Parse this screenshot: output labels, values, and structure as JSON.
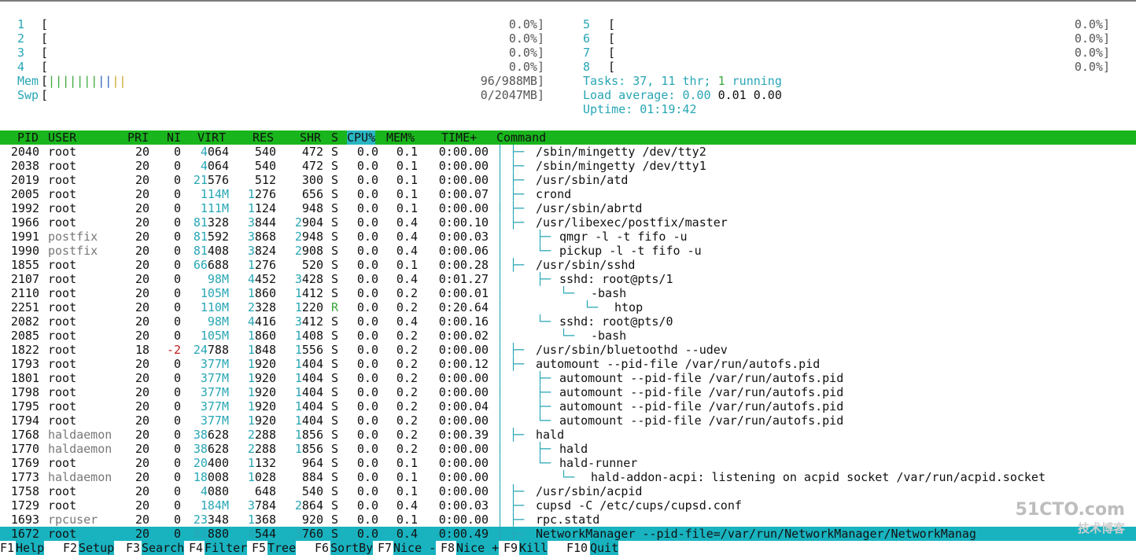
{
  "cpus_left": [
    {
      "id": "1",
      "value": "0.0%"
    },
    {
      "id": "2",
      "value": "0.0%"
    },
    {
      "id": "3",
      "value": "0.0%"
    },
    {
      "id": "4",
      "value": "0.0%"
    }
  ],
  "cpus_right": [
    {
      "id": "5",
      "value": "0.0%"
    },
    {
      "id": "6",
      "value": "0.0%"
    },
    {
      "id": "7",
      "value": "0.0%"
    },
    {
      "id": "8",
      "value": "0.0%"
    }
  ],
  "mem": {
    "label": "Mem",
    "bar": "|||||||||||",
    "value": "96/988MB"
  },
  "swp": {
    "label": "Swp",
    "value": "0/2047MB"
  },
  "tasks": {
    "label": "Tasks:",
    "tasks": "37,",
    "threads": "11",
    "thr_label": "thr;",
    "running": "1",
    "running_label": "running"
  },
  "load": {
    "label": "Load average:",
    "l1": "0.00",
    "l5": "0.01",
    "l15": "0.00"
  },
  "uptime": {
    "label": "Uptime:",
    "value": "01:19:42"
  },
  "header": {
    "pid": "PID",
    "user": "USER",
    "pri": "PRI",
    "ni": "NI",
    "virt": "VIRT",
    "res": "RES",
    "shr": "SHR",
    "s": "S",
    "cpu": "CPU%",
    "mem": "MEM%",
    "time": "TIME+",
    "command": "Command"
  },
  "processes": [
    {
      "pid": "2040",
      "user": "root",
      "pri": "20",
      "ni": "0",
      "virt": "4064",
      "res": "540",
      "shr": "472",
      "s": "S",
      "cpu": "0.0",
      "mem": "0.1",
      "time": "0:00.00",
      "tree": "├─",
      "indent": 0,
      "command": "/sbin/mingetty /dev/tty2"
    },
    {
      "pid": "2038",
      "user": "root",
      "pri": "20",
      "ni": "0",
      "virt": "4064",
      "res": "540",
      "shr": "472",
      "s": "S",
      "cpu": "0.0",
      "mem": "0.1",
      "time": "0:00.00",
      "tree": "├─",
      "indent": 0,
      "command": "/sbin/mingetty /dev/tty1"
    },
    {
      "pid": "2019",
      "user": "root",
      "pri": "20",
      "ni": "0",
      "virt": "21576",
      "res": "512",
      "shr": "300",
      "s": "S",
      "cpu": "0.0",
      "mem": "0.1",
      "time": "0:00.00",
      "tree": "├─",
      "indent": 0,
      "command": "/usr/sbin/atd"
    },
    {
      "pid": "2005",
      "user": "root",
      "pri": "20",
      "ni": "0",
      "virt": "114M",
      "res": "1276",
      "shr": "656",
      "s": "S",
      "cpu": "0.0",
      "mem": "0.1",
      "time": "0:00.07",
      "tree": "├─",
      "indent": 0,
      "command": "crond"
    },
    {
      "pid": "1992",
      "user": "root",
      "pri": "20",
      "ni": "0",
      "virt": "111M",
      "res": "1124",
      "shr": "948",
      "s": "S",
      "cpu": "0.0",
      "mem": "0.1",
      "time": "0:00.00",
      "tree": "├─",
      "indent": 0,
      "command": "/usr/sbin/abrtd"
    },
    {
      "pid": "1966",
      "user": "root",
      "pri": "20",
      "ni": "0",
      "virt": "81328",
      "res": "3844",
      "shr": "2904",
      "s": "S",
      "cpu": "0.0",
      "mem": "0.4",
      "time": "0:00.10",
      "tree": "├─",
      "indent": 0,
      "command": "/usr/libexec/postfix/master"
    },
    {
      "pid": "1991",
      "user": "postfix",
      "pri": "20",
      "ni": "0",
      "virt": "81592",
      "res": "3868",
      "shr": "2948",
      "s": "S",
      "cpu": "0.0",
      "mem": "0.4",
      "time": "0:00.03",
      "tree": "├─",
      "indent": 1,
      "command": "qmgr -l -t fifo -u"
    },
    {
      "pid": "1990",
      "user": "postfix",
      "pri": "20",
      "ni": "0",
      "virt": "81408",
      "res": "3824",
      "shr": "2908",
      "s": "S",
      "cpu": "0.0",
      "mem": "0.4",
      "time": "0:00.06",
      "tree": "└─",
      "indent": 1,
      "command": "pickup -l -t fifo -u"
    },
    {
      "pid": "1855",
      "user": "root",
      "pri": "20",
      "ni": "0",
      "virt": "66688",
      "res": "1276",
      "shr": "520",
      "s": "S",
      "cpu": "0.0",
      "mem": "0.1",
      "time": "0:00.28",
      "tree": "├─",
      "indent": 0,
      "command": "/usr/sbin/sshd"
    },
    {
      "pid": "2107",
      "user": "root",
      "pri": "20",
      "ni": "0",
      "virt": "98M",
      "res": "4452",
      "shr": "3428",
      "s": "S",
      "cpu": "0.0",
      "mem": "0.4",
      "time": "0:01.27",
      "tree": "├─",
      "indent": 1,
      "command": "sshd: root@pts/1"
    },
    {
      "pid": "2110",
      "user": "root",
      "pri": "20",
      "ni": "0",
      "virt": "105M",
      "res": "1860",
      "shr": "1412",
      "s": "S",
      "cpu": "0.0",
      "mem": "0.2",
      "time": "0:00.01",
      "tree": "└─",
      "indent": 2,
      "command": "-bash"
    },
    {
      "pid": "2251",
      "user": "root",
      "pri": "20",
      "ni": "0",
      "virt": "110M",
      "res": "2328",
      "shr": "1220",
      "s": "R",
      "cpu": "0.0",
      "mem": "0.2",
      "time": "0:20.64",
      "tree": "└─",
      "indent": 3,
      "command": "htop"
    },
    {
      "pid": "2082",
      "user": "root",
      "pri": "20",
      "ni": "0",
      "virt": "98M",
      "res": "4416",
      "shr": "3412",
      "s": "S",
      "cpu": "0.0",
      "mem": "0.4",
      "time": "0:00.16",
      "tree": "└─",
      "indent": 1,
      "command": "sshd: root@pts/0"
    },
    {
      "pid": "2085",
      "user": "root",
      "pri": "20",
      "ni": "0",
      "virt": "105M",
      "res": "1860",
      "shr": "1408",
      "s": "S",
      "cpu": "0.0",
      "mem": "0.2",
      "time": "0:00.02",
      "tree": "└─",
      "indent": 2,
      "command": "-bash"
    },
    {
      "pid": "1822",
      "user": "root",
      "pri": "18",
      "ni": "-2",
      "virt": "24788",
      "res": "1848",
      "shr": "1556",
      "s": "S",
      "cpu": "0.0",
      "mem": "0.2",
      "time": "0:00.00",
      "tree": "├─",
      "indent": 0,
      "command": "/usr/sbin/bluetoothd --udev"
    },
    {
      "pid": "1793",
      "user": "root",
      "pri": "20",
      "ni": "0",
      "virt": "377M",
      "res": "1920",
      "shr": "1404",
      "s": "S",
      "cpu": "0.0",
      "mem": "0.2",
      "time": "0:00.12",
      "tree": "├─",
      "indent": 0,
      "command": "automount --pid-file /var/run/autofs.pid"
    },
    {
      "pid": "1801",
      "user": "root",
      "pri": "20",
      "ni": "0",
      "virt": "377M",
      "res": "1920",
      "shr": "1404",
      "s": "S",
      "cpu": "0.0",
      "mem": "0.2",
      "time": "0:00.00",
      "tree": "├─",
      "indent": 1,
      "command": "automount --pid-file /var/run/autofs.pid"
    },
    {
      "pid": "1798",
      "user": "root",
      "pri": "20",
      "ni": "0",
      "virt": "377M",
      "res": "1920",
      "shr": "1404",
      "s": "S",
      "cpu": "0.0",
      "mem": "0.2",
      "time": "0:00.00",
      "tree": "├─",
      "indent": 1,
      "command": "automount --pid-file /var/run/autofs.pid"
    },
    {
      "pid": "1795",
      "user": "root",
      "pri": "20",
      "ni": "0",
      "virt": "377M",
      "res": "1920",
      "shr": "1404",
      "s": "S",
      "cpu": "0.0",
      "mem": "0.2",
      "time": "0:00.04",
      "tree": "├─",
      "indent": 1,
      "command": "automount --pid-file /var/run/autofs.pid"
    },
    {
      "pid": "1794",
      "user": "root",
      "pri": "20",
      "ni": "0",
      "virt": "377M",
      "res": "1920",
      "shr": "1404",
      "s": "S",
      "cpu": "0.0",
      "mem": "0.2",
      "time": "0:00.00",
      "tree": "└─",
      "indent": 1,
      "command": "automount --pid-file /var/run/autofs.pid"
    },
    {
      "pid": "1768",
      "user": "haldaemon",
      "pri": "20",
      "ni": "0",
      "virt": "38628",
      "res": "2288",
      "shr": "1856",
      "s": "S",
      "cpu": "0.0",
      "mem": "0.2",
      "time": "0:00.39",
      "tree": "├─",
      "indent": 0,
      "command": "hald"
    },
    {
      "pid": "1770",
      "user": "haldaemon",
      "pri": "20",
      "ni": "0",
      "virt": "38628",
      "res": "2288",
      "shr": "1856",
      "s": "S",
      "cpu": "0.0",
      "mem": "0.2",
      "time": "0:00.00",
      "tree": "├─",
      "indent": 1,
      "command": "hald"
    },
    {
      "pid": "1769",
      "user": "root",
      "pri": "20",
      "ni": "0",
      "virt": "20400",
      "res": "1132",
      "shr": "964",
      "s": "S",
      "cpu": "0.0",
      "mem": "0.1",
      "time": "0:00.00",
      "tree": "└─",
      "indent": 1,
      "command": "hald-runner"
    },
    {
      "pid": "1773",
      "user": "haldaemon",
      "pri": "20",
      "ni": "0",
      "virt": "18008",
      "res": "1028",
      "shr": "884",
      "s": "S",
      "cpu": "0.0",
      "mem": "0.1",
      "time": "0:00.00",
      "tree": "└─",
      "indent": 2,
      "command": "hald-addon-acpi: listening on acpid socket /var/run/acpid.socket"
    },
    {
      "pid": "1758",
      "user": "root",
      "pri": "20",
      "ni": "0",
      "virt": "4080",
      "res": "648",
      "shr": "540",
      "s": "S",
      "cpu": "0.0",
      "mem": "0.1",
      "time": "0:00.00",
      "tree": "├─",
      "indent": 0,
      "command": "/usr/sbin/acpid"
    },
    {
      "pid": "1729",
      "user": "root",
      "pri": "20",
      "ni": "0",
      "virt": "184M",
      "res": "3784",
      "shr": "2864",
      "s": "S",
      "cpu": "0.0",
      "mem": "0.4",
      "time": "0:00.03",
      "tree": "├─",
      "indent": 0,
      "command": "cupsd -C /etc/cups/cupsd.conf"
    },
    {
      "pid": "1693",
      "user": "rpcuser",
      "pri": "20",
      "ni": "0",
      "virt": "23348",
      "res": "1368",
      "shr": "920",
      "s": "S",
      "cpu": "0.0",
      "mem": "0.1",
      "time": "0:00.00",
      "tree": "├─",
      "indent": 0,
      "command": "rpc.statd"
    },
    {
      "pid": "1672",
      "user": "root",
      "pri": "20",
      "ni": "0",
      "virt": "82880",
      "res": "4544",
      "shr": "3760",
      "s": "S",
      "cpu": "0.0",
      "mem": "0.4",
      "time": "0:00.49",
      "tree": "├─",
      "indent": 0,
      "command": "NetworkManager --pid-file=/var/run/NetworkManager/NetworkManag",
      "selected": true
    }
  ],
  "footer": [
    {
      "key": "F1",
      "label": "Help"
    },
    {
      "key": "F2",
      "label": "Setup"
    },
    {
      "key": "F3",
      "label": "Search"
    },
    {
      "key": "F4",
      "label": "Filter"
    },
    {
      "key": "F5",
      "label": "Tree"
    },
    {
      "key": "F6",
      "label": "SortBy"
    },
    {
      "key": "F7",
      "label": "Nice -"
    },
    {
      "key": "F8",
      "label": "Nice +"
    },
    {
      "key": "F9",
      "label": "Kill"
    },
    {
      "key": "F10",
      "label": "Quit"
    }
  ],
  "watermark": {
    "brand": "51CTO.com",
    "sub": "技术博客"
  }
}
